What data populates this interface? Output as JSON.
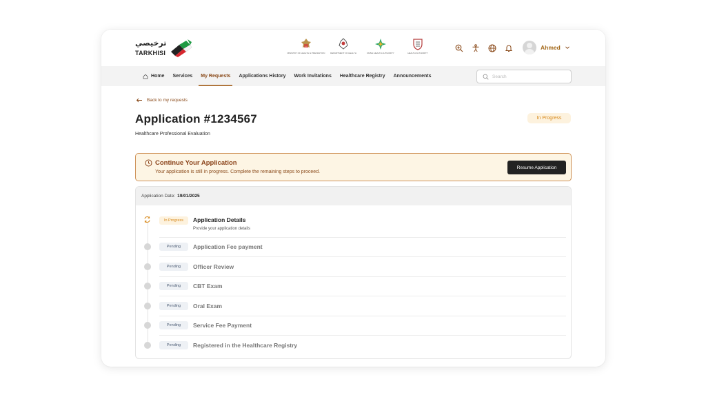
{
  "header": {
    "logo_ar": "ترخيصي",
    "logo_en": "TARKHISI",
    "gov_logos": [
      {
        "name": "ministry-logo",
        "caption": "MINISTRY OF HEALTH & PREVENTION"
      },
      {
        "name": "doh-logo",
        "caption": "DEPARTMENT OF HEALTH"
      },
      {
        "name": "dubai-health-logo",
        "caption": "DUBAI HEALTH AUTHORITY"
      },
      {
        "name": "health-authority-logo",
        "caption": "HEALTH AUTHORITY"
      }
    ],
    "icons": [
      "zoom-in-icon",
      "accessibility-icon",
      "globe-icon",
      "bell-icon"
    ],
    "user_name": "Ahmed"
  },
  "nav": {
    "items": [
      {
        "label": "Home",
        "icon": "home-icon"
      },
      {
        "label": "Services"
      },
      {
        "label": "My Requests",
        "active": true
      },
      {
        "label": "Applications History"
      },
      {
        "label": "Work Invitations"
      },
      {
        "label": "Healthcare Registry"
      },
      {
        "label": "Announcements"
      }
    ],
    "search_placeholder": "Search"
  },
  "page": {
    "back_label": "Back  to my requests",
    "title": "Application #1234567",
    "subtitle": "Healthcare Professional Evaluation",
    "status": "In Progress"
  },
  "banner": {
    "title": "Continue Your Application",
    "text": "Your application is still in progress. Complete the remaining steps to proceed.",
    "button": "Resume Application"
  },
  "steps": {
    "date_label": "Application Date:",
    "date_value": "19/01/2025",
    "items": [
      {
        "status": "In Progress",
        "title": "Application Details",
        "description": "Provide your application details"
      },
      {
        "status": "Pending",
        "title": "Application Fee payment"
      },
      {
        "status": "Pending",
        "title": "Officer Review"
      },
      {
        "status": "Pending",
        "title": "CBT Exam"
      },
      {
        "status": "Pending",
        "title": "Oral Exam"
      },
      {
        "status": "Pending",
        "title": "Service Fee Payment"
      },
      {
        "status": "Pending",
        "title": "Registered in the Healthcare Registry"
      }
    ]
  },
  "colors": {
    "accent": "#8a4a1a",
    "progress": "#d7891b",
    "progress_bg": "#fdf2de",
    "banner_bg": "#fdf5e4",
    "banner_border": "#cf9359"
  }
}
